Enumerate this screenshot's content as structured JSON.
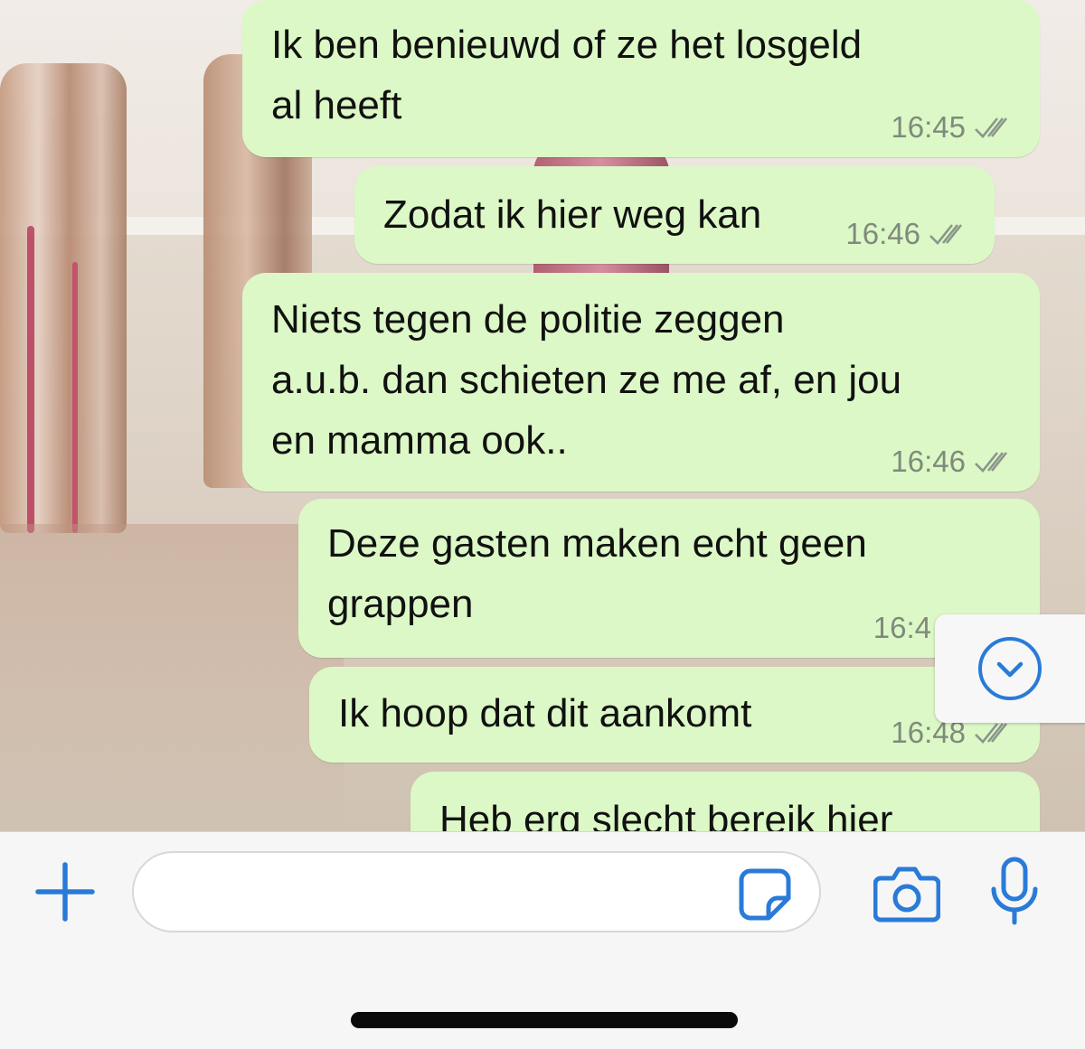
{
  "chat": {
    "messages": [
      {
        "text": "Ik ben benieuwd of ze het losgeld\nal heeft",
        "time": "16:45"
      },
      {
        "text": "Zodat ik hier weg kan",
        "time": "16:46"
      },
      {
        "text": "Niets tegen de politie zeggen\na.u.b. dan schieten ze me af, en jou\nen mamma ook..",
        "time": "16:46"
      },
      {
        "text": "Deze gasten maken echt geen\ngrappen",
        "time": "16:4"
      },
      {
        "text": "Ik hoop dat dit aankomt",
        "time": "16:48"
      },
      {
        "text": "Heb erg slecht bereik hier",
        "time": ""
      }
    ]
  },
  "input": {
    "placeholder": "",
    "value": ""
  },
  "icons": {
    "plus": "plus-icon",
    "sticker": "sticker-icon",
    "camera": "camera-icon",
    "mic": "microphone-icon",
    "scroll_down": "chevron-down-icon",
    "read_receipt": "double-check-icon"
  },
  "colors": {
    "outgoing_bubble": "#dcf8c6",
    "accent": "#2a7bd8",
    "timestamp": "#7f8a7c",
    "input_bar": "#f6f6f6"
  }
}
